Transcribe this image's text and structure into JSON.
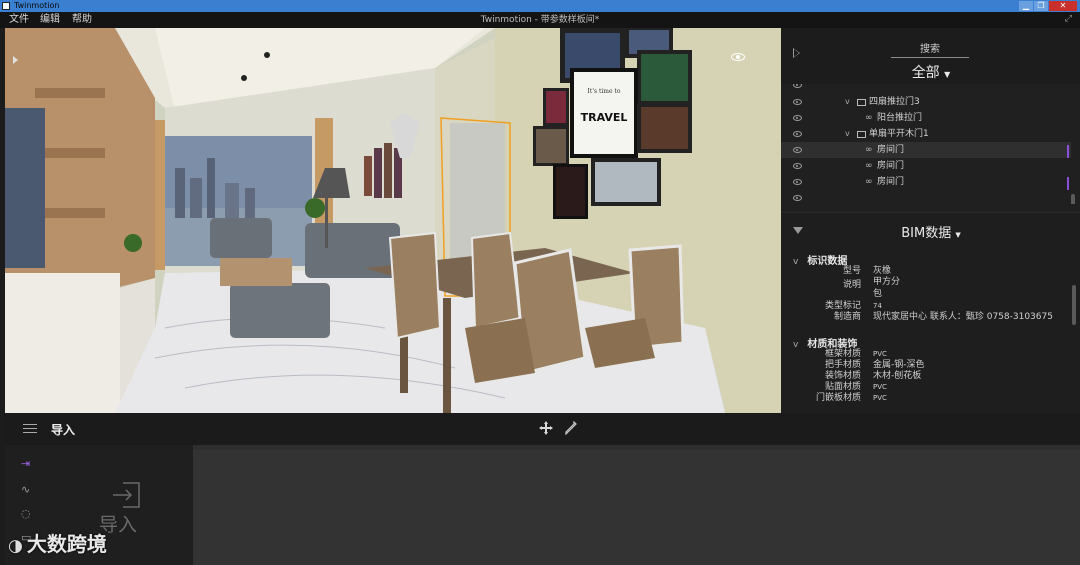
{
  "window": {
    "app_name": "Twinmotion",
    "document_title": "Twinmotion - 带参数样板间*"
  },
  "menu": {
    "file": "文件",
    "edit": "编辑",
    "help": "帮助"
  },
  "viewport": {
    "poster_text_small": "It's time to",
    "poster_text_big": "TRAVEL"
  },
  "scene_panel": {
    "search_label": "搜索",
    "filter_label": "全部",
    "tree": [
      {
        "label": "四扇推拉门3",
        "type": "folder",
        "level": 1
      },
      {
        "label": "阳台推拉门",
        "type": "item",
        "level": 2
      },
      {
        "label": "单扇平开木门1",
        "type": "folder",
        "level": 1
      },
      {
        "label": "房间门",
        "type": "item",
        "level": 2,
        "selected": true
      },
      {
        "label": "房间门",
        "type": "item",
        "level": 2
      },
      {
        "label": "房间门",
        "type": "item",
        "level": 2
      }
    ]
  },
  "bim_panel": {
    "title": "BIM数据",
    "groups": [
      {
        "title": "标识数据",
        "props": [
          {
            "key": "型号",
            "value": "灰橡"
          },
          {
            "key": "说明",
            "value": "甲方分"
          },
          {
            "key": "",
            "value": "包"
          },
          {
            "key": "类型标记",
            "value": "74"
          },
          {
            "key": "制造商",
            "value": "现代家居中心 联系人：甄珍 0758-3103675"
          }
        ]
      },
      {
        "title": "材质和装饰",
        "props": [
          {
            "key": "框架材质",
            "value": "PVC"
          },
          {
            "key": "把手材质",
            "value": "金属-钢-深色"
          },
          {
            "key": "装饰材质",
            "value": "木材-刨花板"
          },
          {
            "key": "贴面材质",
            "value": "PVC"
          },
          {
            "key": "门嵌板材质",
            "value": "PVC"
          }
        ]
      }
    ]
  },
  "bottom": {
    "section_title": "导入",
    "import_label": "导入"
  },
  "watermark": "大数跨境",
  "colors": {
    "accent": "#9b63e8",
    "selection_outline": "#f0a020",
    "close_button": "#c9302c",
    "titlebar": "#3a7fd0"
  }
}
